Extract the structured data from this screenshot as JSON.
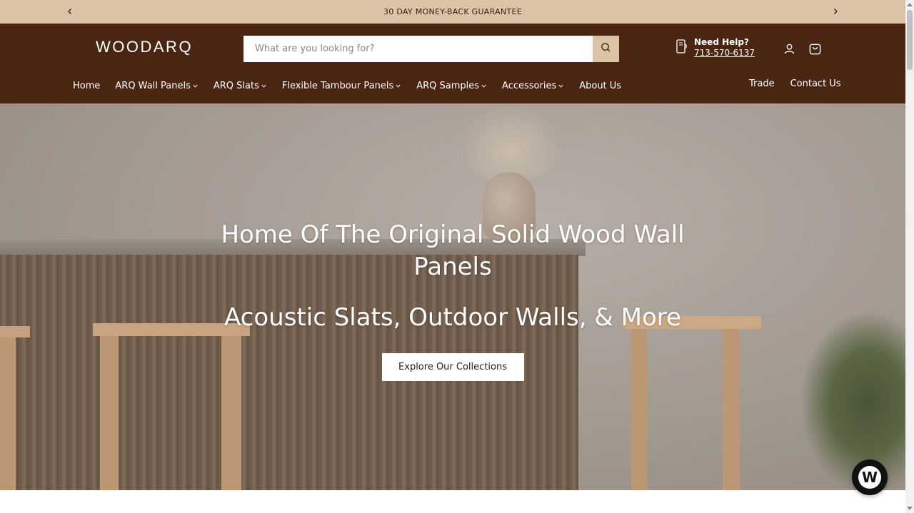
{
  "announcement": {
    "text": "30 DAY MONEY-BACK GUARANTEE",
    "prev_icon": "chevron-left-icon",
    "next_icon": "chevron-right-icon"
  },
  "header": {
    "logo": "WOODARQ",
    "search": {
      "placeholder": "What are you looking for?",
      "value": "",
      "icon": "search-icon"
    },
    "help": {
      "title": "Need Help?",
      "phone": "713-570-6137",
      "icon": "phone-icon"
    },
    "account_icon": "account-icon",
    "cart_icon": "cart-icon"
  },
  "nav": {
    "items": [
      {
        "label": "Home",
        "dropdown": false
      },
      {
        "label": "ARQ Wall Panels",
        "dropdown": true
      },
      {
        "label": "ARQ Slats",
        "dropdown": true
      },
      {
        "label": "Flexible Tambour Panels",
        "dropdown": true
      },
      {
        "label": "ARQ Samples",
        "dropdown": true
      },
      {
        "label": "Accessories",
        "dropdown": true
      },
      {
        "label": "About Us",
        "dropdown": false
      }
    ],
    "right": [
      {
        "label": "Trade"
      },
      {
        "label": "Contact Us"
      }
    ]
  },
  "hero": {
    "title": "Home Of The Original Solid Wood Wall Panels",
    "subtitle": "Acoustic Slats, Outdoor Walls, & More",
    "cta": "Explore Our Collections"
  },
  "chat": {
    "icon": "chat-widget-icon",
    "glyph": "W"
  },
  "colors": {
    "announcement_bg": "#dcc3a6",
    "header_bg": "#4a2512",
    "search_button_bg": "#dcc3a6",
    "text_light": "#ffffff"
  }
}
